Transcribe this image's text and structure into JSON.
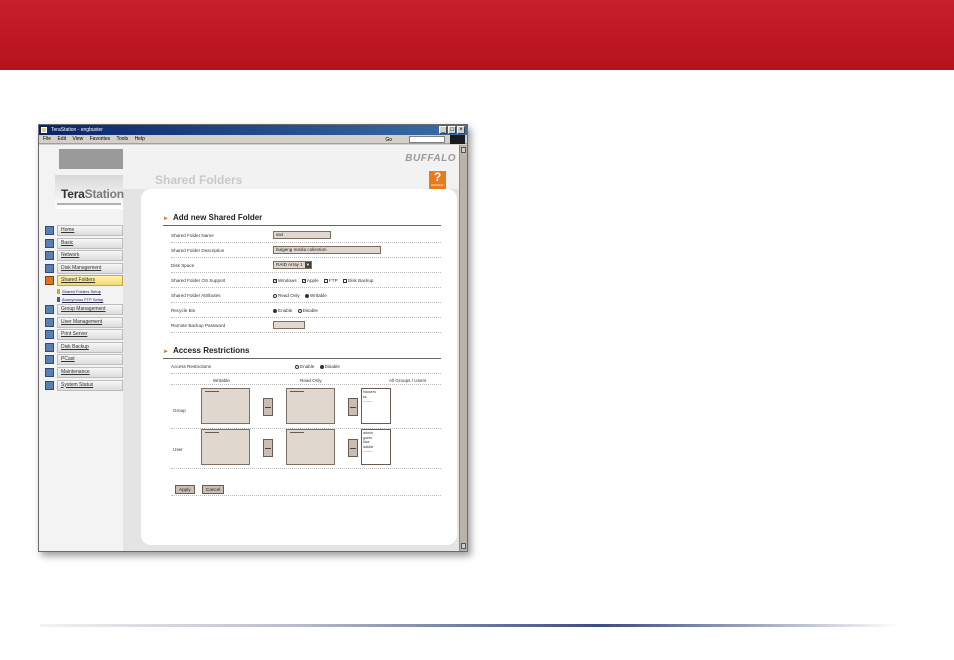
{
  "window": {
    "title": "TeraStation - engbuster",
    "menu": [
      "File",
      "Edit",
      "View",
      "Favorites",
      "Tools",
      "Help"
    ],
    "go_label": "Go"
  },
  "sidebar": {
    "logo_tera": "Tera",
    "logo_station": "Station",
    "items": [
      {
        "label": "Home"
      },
      {
        "label": "Basic"
      },
      {
        "label": "Network"
      },
      {
        "label": "Disk Management"
      },
      {
        "label": "Shared Folders",
        "active": true
      },
      {
        "label": "Group Management"
      },
      {
        "label": "User Management"
      },
      {
        "label": "Print Server"
      },
      {
        "label": "Disk Backup"
      },
      {
        "label": "PCast"
      },
      {
        "label": "Maintenance"
      },
      {
        "label": "System Status"
      }
    ],
    "subitems": [
      "Shared Folders Setup",
      "Anonymous FTP Setup"
    ]
  },
  "header": {
    "brand": "BUFFALO",
    "page_title": "Shared Folders",
    "help_label": "MANUAL"
  },
  "add_folder": {
    "title": "Add new Shared Folder",
    "rows": {
      "name": {
        "label": "Shared Folder Name",
        "value": "vwt"
      },
      "description": {
        "label": "Shared Folder Description",
        "value": "bulgeng media collection"
      },
      "disk_space": {
        "label": "Disk Space",
        "value": "RAID Array 1"
      },
      "os_support": {
        "label": "Shared Folder OS Support",
        "options": [
          "Windows",
          "Apple",
          "FTP",
          "Disk Backup"
        ]
      },
      "attributes": {
        "label": "Shared Folder Attributes",
        "options": [
          "Read Only",
          "Writable"
        ],
        "selected": "Writable"
      },
      "recycle": {
        "label": "Recycle Bin",
        "options": [
          "Enable",
          "Disable"
        ],
        "selected": "Enable"
      },
      "backup_password": {
        "label": "Remote Backup Password",
        "value": ""
      }
    }
  },
  "access": {
    "title": "Access Restrictions",
    "label": "Access Restrictions",
    "options": [
      "Enable",
      "Disable"
    ],
    "selected": "Disable",
    "columns": [
      "Writable",
      "Read Only",
      "All Groups / Users"
    ],
    "group_label": "Group",
    "user_label": "User",
    "all_groups": [
      "hdusers",
      "ss",
      "--------"
    ],
    "all_users": [
      "admin",
      "guest",
      "tilza",
      "dakkie",
      "--------"
    ]
  },
  "buttons": {
    "apply": "Apply",
    "cancel": "Cancel"
  }
}
